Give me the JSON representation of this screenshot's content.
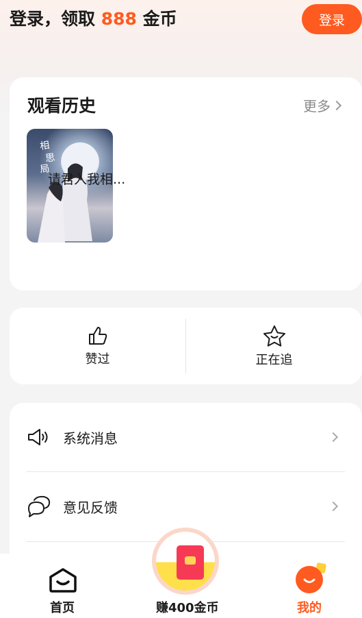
{
  "header": {
    "login_prefix": "登录，领取 ",
    "coin_amount": "888",
    "login_suffix": " 金币",
    "login_button": "登录"
  },
  "history": {
    "title": "观看历史",
    "more": "更多",
    "items": [
      {
        "title": "请君入我相..."
      }
    ]
  },
  "actions": {
    "liked": "赞过",
    "following": "正在追"
  },
  "menu": {
    "items": [
      {
        "label": "系统消息",
        "icon": "speaker-icon"
      },
      {
        "label": "意见反馈",
        "icon": "chat-bubbles-icon"
      }
    ]
  },
  "bottom_nav": {
    "home": "首页",
    "earn": "赚400金币",
    "me": "我的",
    "active": "me",
    "accent_color": "#ff5a1f"
  }
}
